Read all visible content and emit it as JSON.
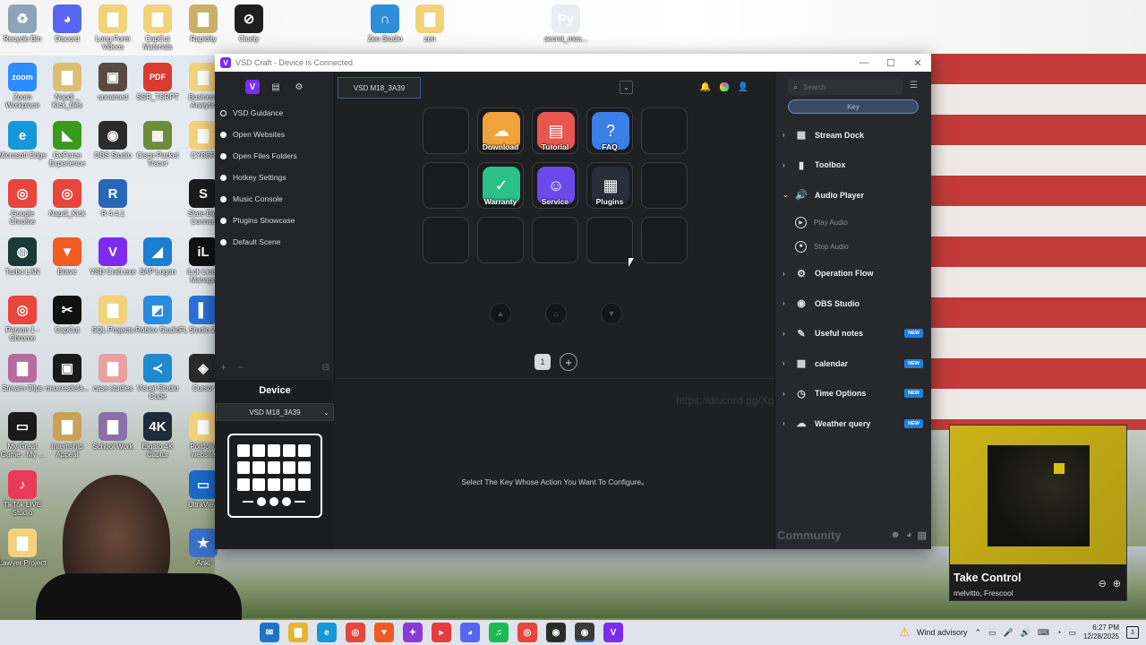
{
  "desktop": {
    "icons": [
      {
        "label": "Recycle Bin",
        "icon": "recycle-bin-icon",
        "color": "#8fa3b8",
        "glyph": "♻"
      },
      {
        "label": "Discord",
        "icon": "discord-icon",
        "color": "#5865f2",
        "glyph": "◕"
      },
      {
        "label": "Long Form Videos",
        "icon": "folder-icon",
        "color": "#f2d27a",
        "glyph": "▇"
      },
      {
        "label": "CapCut Materials",
        "icon": "folder-icon",
        "color": "#f2d27a",
        "glyph": "▇"
      },
      {
        "label": "Rapidity",
        "icon": "folder-icon",
        "color": "#c9b06a",
        "glyph": "▇"
      },
      {
        "label": "Cluely",
        "icon": "cluely-icon",
        "color": "#1e1e1e",
        "glyph": "⊘"
      },
      {
        "label": "Zen Studio",
        "icon": "zen-studio-icon",
        "color": "#2e8fd8",
        "glyph": "∩"
      },
      {
        "label": "zen",
        "icon": "folder-icon",
        "color": "#f2d27a",
        "glyph": "▇"
      },
      {
        "label": "secret_mes...",
        "icon": "python-file-icon",
        "color": "#e9edf2",
        "glyph": "Py"
      },
      {
        "label": "Zoom Workplace",
        "icon": "zoom-icon",
        "color": "#2d8cff",
        "glyph": "zoom"
      },
      {
        "label": "Napdi _ Kick_files",
        "icon": "folder-icon",
        "color": "#d9c070",
        "glyph": "▇"
      },
      {
        "label": "unnamed",
        "icon": "image-file-icon",
        "color": "#5a4a44",
        "glyph": "▣"
      },
      {
        "label": "SSR_TSRPT",
        "icon": "pdf-icon",
        "color": "#d93b2e",
        "glyph": "PDF"
      },
      {
        "label": "Business Analytic",
        "icon": "folder-icon",
        "color": "#f2d27a",
        "glyph": "▇"
      },
      {
        "label": "Microsoft Edge",
        "icon": "edge-icon",
        "color": "#1597d9",
        "glyph": "e"
      },
      {
        "label": "GeForce Experience",
        "icon": "geforce-icon",
        "color": "#3a9b1a",
        "glyph": "◣"
      },
      {
        "label": "OBS Studio",
        "icon": "obs-icon",
        "color": "#2b2b2b",
        "glyph": "◉"
      },
      {
        "label": "Cisco Packet Tracer",
        "icon": "packet-tracer-icon",
        "color": "#6b8c3a",
        "glyph": "▦"
      },
      {
        "label": "CYBER",
        "icon": "folder-icon",
        "color": "#f2d27a",
        "glyph": "▇"
      },
      {
        "label": "Google Chrome",
        "icon": "chrome-icon",
        "color": "#e8453c",
        "glyph": "◎"
      },
      {
        "label": "Napdi_Kick",
        "icon": "chrome-icon",
        "color": "#e8453c",
        "glyph": "◎"
      },
      {
        "label": "R 4.4.1",
        "icon": "r-icon",
        "color": "#2767b8",
        "glyph": "R"
      },
      {
        "label": "Slate Digi Connec",
        "icon": "slate-icon",
        "color": "#1b1b1b",
        "glyph": "S"
      },
      {
        "label": "Turbo LAN",
        "icon": "turbo-lan-icon",
        "color": "#1a3a3a",
        "glyph": "◍"
      },
      {
        "label": "Brave",
        "icon": "brave-icon",
        "color": "#f25a24",
        "glyph": "▼"
      },
      {
        "label": "VSD Craft.exe",
        "icon": "vsd-craft-icon",
        "color": "#7b2cf0",
        "glyph": "V"
      },
      {
        "label": "SAP Logon",
        "icon": "sap-icon",
        "color": "#1a7fd1",
        "glyph": "◢"
      },
      {
        "label": "iLok Licen Manage",
        "icon": "ilok-icon",
        "color": "#111111",
        "glyph": "iL"
      },
      {
        "label": "Person 1 - Chrome",
        "icon": "chrome-icon",
        "color": "#e8453c",
        "glyph": "◎"
      },
      {
        "label": "CapCut",
        "icon": "capcut-icon",
        "color": "#111111",
        "glyph": "✂"
      },
      {
        "label": "SQL Projects",
        "icon": "folder-icon",
        "color": "#f2d27a",
        "glyph": "▇"
      },
      {
        "label": "Roblox Studio",
        "icon": "roblox-icon",
        "color": "#2a8ce0",
        "glyph": "◩"
      },
      {
        "label": "FL Studio 2024",
        "icon": "fl-studio-icon",
        "color": "#2c6fd8",
        "glyph": "▌"
      },
      {
        "label": "Stream Clips",
        "icon": "folder-icon",
        "color": "#b86b9e",
        "glyph": "▇"
      },
      {
        "label": "maxresdefa...",
        "icon": "image-file-icon",
        "color": "#1a1a1a",
        "glyph": "▣"
      },
      {
        "label": "case studies",
        "icon": "folder-icon",
        "color": "#e8a0a0",
        "glyph": "▇"
      },
      {
        "label": "Visual Studio Code",
        "icon": "vscode-icon",
        "color": "#1f8ad2",
        "glyph": "≺"
      },
      {
        "label": "Cursor",
        "icon": "cursor-app-icon",
        "color": "#2a2a2a",
        "glyph": "◈"
      },
      {
        "label": "My Great Game - My ...",
        "icon": "game-file-icon",
        "color": "#1a1a1a",
        "glyph": "▭"
      },
      {
        "label": "Internship Appeal",
        "icon": "folder-icon",
        "color": "#c9a25a",
        "glyph": "▇"
      },
      {
        "label": "School Work",
        "icon": "folder-icon",
        "color": "#8a6fa8",
        "glyph": "▇"
      },
      {
        "label": "Elgato 4K Captur",
        "icon": "elgato-icon",
        "color": "#1d2a3a",
        "glyph": "4K"
      },
      {
        "label": "Portfolio website",
        "icon": "folder-icon",
        "color": "#f2d27a",
        "glyph": "▇"
      },
      {
        "label": "TikTok LIVE Studio",
        "icon": "tiktok-icon",
        "color": "#e83a5a",
        "glyph": "♪"
      },
      {
        "label": "UltraView",
        "icon": "ultraview-icon",
        "color": "#1a6ac9",
        "glyph": "▭"
      },
      {
        "label": "Lawyer Project",
        "icon": "folder-icon",
        "color": "#f2d27a",
        "glyph": "▇"
      },
      {
        "label": "Anki",
        "icon": "anki-icon",
        "color": "#3a72c9",
        "glyph": "★"
      }
    ]
  },
  "window": {
    "title": "VSD Craft - Device is Connected",
    "controls": [
      "—",
      "☐",
      "✕"
    ]
  },
  "left_pane": {
    "top_icons": [
      "V",
      "▤",
      "⚙"
    ],
    "menu": [
      "VSD Guidance",
      "Open Websites",
      "Open Files Folders",
      "Hotkey Settings",
      "Music Console",
      "Plugins Showcase",
      "Default Scene"
    ],
    "tools": {
      "add": "+",
      "remove": "−",
      "misc": "⊟"
    },
    "device": {
      "title": "Device",
      "selected": "VSD M18_3A39",
      "chevron": "⌄"
    }
  },
  "center": {
    "device_tab": "VSD M18_3A39",
    "dropdown_glyph": "⌄",
    "top_right_icons": [
      "🔔",
      "",
      "👤"
    ],
    "keys": [
      {
        "label": "",
        "glyph": "",
        "color": ""
      },
      {
        "label": "Download",
        "glyph": "☁",
        "color": "#f2a23a"
      },
      {
        "label": "Tutorial",
        "glyph": "▤",
        "color": "#e8574e"
      },
      {
        "label": "FAQ",
        "glyph": "?",
        "color": "#3a7ee8"
      },
      {
        "label": "",
        "glyph": "",
        "color": ""
      },
      {
        "label": "",
        "glyph": "",
        "color": ""
      },
      {
        "label": "Warranty",
        "glyph": "✓",
        "color": "#2bbf8a"
      },
      {
        "label": "Service",
        "glyph": "☺",
        "color": "#6a4ae8"
      },
      {
        "label": "Plugins",
        "glyph": "▦",
        "color": "#2a2d3a"
      },
      {
        "label": "",
        "glyph": "",
        "color": ""
      },
      {
        "label": "",
        "glyph": "",
        "color": ""
      },
      {
        "label": "",
        "glyph": "",
        "color": ""
      },
      {
        "label": "",
        "glyph": "",
        "color": ""
      },
      {
        "label": "",
        "glyph": "",
        "color": ""
      },
      {
        "label": "",
        "glyph": "",
        "color": ""
      }
    ],
    "knobs": [
      "▲",
      "⌂",
      "▼"
    ],
    "page_number": "1",
    "add_page": "+",
    "watermark": "https://discord.gg/XgPbkZ23",
    "configure_message": "Select The Key Whose Action You Want To Configure。"
  },
  "right_pane": {
    "search_placeholder": "Search",
    "search_glyph": "⌕",
    "list_glyph": "☰",
    "key_tab": "Key",
    "categories": [
      {
        "label": "Stream Dock",
        "arrow": "›",
        "glyph": "▦",
        "new": ""
      },
      {
        "label": "Toolbox",
        "arrow": "›",
        "glyph": "▮",
        "new": ""
      },
      {
        "label": "Audio Player",
        "arrow": "⌄",
        "glyph": "🔊",
        "new": ""
      }
    ],
    "audio_sub": [
      {
        "label": "Play Audio",
        "glyph": "▶"
      },
      {
        "label": "Stop Audio",
        "glyph": "■"
      }
    ],
    "categories_after": [
      {
        "label": "Operation Flow",
        "arrow": "›",
        "glyph": "⚙",
        "new": ""
      },
      {
        "label": "OBS Studio",
        "arrow": "›",
        "glyph": "◉",
        "new": ""
      },
      {
        "label": "Useful notes",
        "arrow": "›",
        "glyph": "✎",
        "new": "NEW"
      },
      {
        "label": "calendar",
        "arrow": "›",
        "glyph": "▦",
        "new": "NEW"
      },
      {
        "label": "Time Options",
        "arrow": "›",
        "glyph": "◷",
        "new": "NEW"
      },
      {
        "label": "Weather query",
        "arrow": "›",
        "glyph": "☁",
        "new": "NEW"
      }
    ],
    "community": "Community",
    "community_icons": [
      "☻",
      "◕",
      "▤"
    ]
  },
  "player": {
    "title": "Take Control",
    "artist": "melvitto, Frescool",
    "controls": [
      "⊖",
      "⊕"
    ]
  },
  "taskbar": {
    "apps": [
      {
        "name": "mail",
        "glyph": "✉",
        "color": "#1e73c8"
      },
      {
        "name": "file-explorer",
        "glyph": "▇",
        "color": "#e8b52a"
      },
      {
        "name": "edge",
        "glyph": "e",
        "color": "#1597d9"
      },
      {
        "name": "chrome",
        "glyph": "◎",
        "color": "#e8453c"
      },
      {
        "name": "brave",
        "glyph": "▼",
        "color": "#f25a24"
      },
      {
        "name": "multi",
        "glyph": "✦",
        "color": "#8a3ad9"
      },
      {
        "name": "snip",
        "glyph": "▸",
        "color": "#e83a3a"
      },
      {
        "name": "discord",
        "glyph": "◕",
        "color": "#5865f2"
      },
      {
        "name": "spotify",
        "glyph": "♫",
        "color": "#1db954"
      },
      {
        "name": "chrome-2",
        "glyph": "◎",
        "color": "#e8453c"
      },
      {
        "name": "camera",
        "glyph": "◉",
        "color": "#2b2b2b"
      },
      {
        "name": "obs",
        "glyph": "◉",
        "color": "#3a3a3a"
      },
      {
        "name": "vsd-craft",
        "glyph": "V",
        "color": "#7b2cf0"
      }
    ],
    "weather_text": "Wind advisory",
    "tray_glyphs": [
      "⌃",
      "▭",
      "🎤",
      "🔊",
      "⌨",
      "◔",
      "▭"
    ],
    "time": "6:27 PM",
    "date": "12/28/2025",
    "notifications": "3"
  }
}
